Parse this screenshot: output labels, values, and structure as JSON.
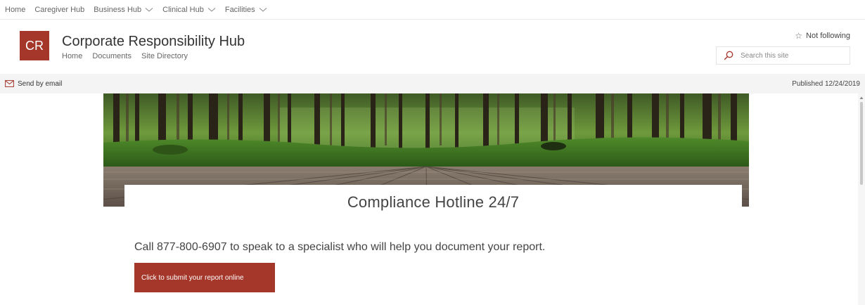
{
  "hub_nav": {
    "items": [
      {
        "label": "Home",
        "has_dropdown": false
      },
      {
        "label": "Caregiver Hub",
        "has_dropdown": false
      },
      {
        "label": "Business Hub",
        "has_dropdown": true
      },
      {
        "label": "Clinical Hub",
        "has_dropdown": true
      },
      {
        "label": "Facilities",
        "has_dropdown": true
      }
    ]
  },
  "site": {
    "logo_initials": "CR",
    "title": "Corporate Responsibility Hub",
    "nav": [
      "Home",
      "Documents",
      "Site Directory"
    ],
    "follow_label": "Not following",
    "search_placeholder": "Search this site"
  },
  "command_bar": {
    "send_email_label": "Send by email",
    "published_label": "Published 12/24/2019"
  },
  "hero": {
    "title": "Compliance Hotline 24/7"
  },
  "content": {
    "call_text": "Call 877-800-6907 to speak to a specialist who will help you document your report.",
    "submit_button_label": "Click to submit your report online"
  },
  "colors": {
    "accent": "#a4362a",
    "command_bar_bg": "#f4f4f4"
  },
  "icons": {
    "follow": "star-outline-icon",
    "search": "search-icon",
    "email": "mail-icon",
    "dropdown": "chevron-down-icon"
  }
}
